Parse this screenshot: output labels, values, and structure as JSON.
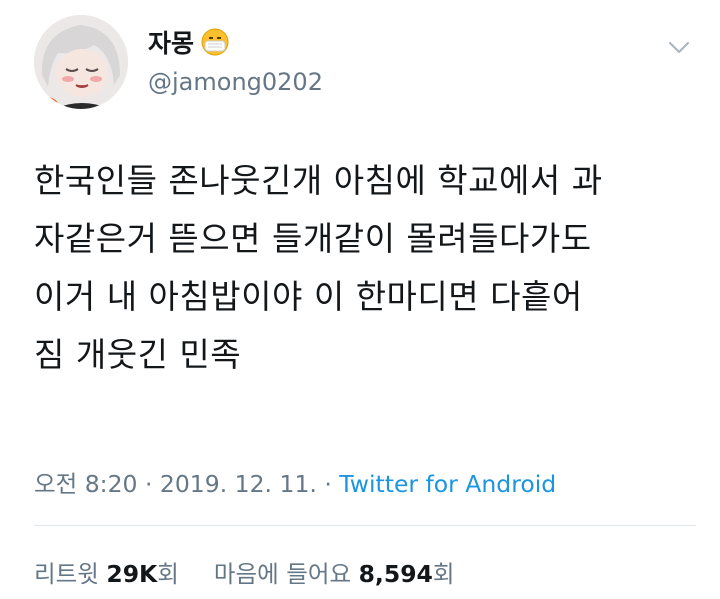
{
  "user": {
    "display_name": "자몽",
    "handle": "@jamong0202",
    "status_emoji": "face-with-medical-mask-icon"
  },
  "tweet": {
    "lines": [
      "한국인들 존나웃긴개 아침에 학교에서 과",
      "자같은거 뜯으면 들개같이 몰려들다가도",
      "이거 내 아침밥이야 이 한마디면 다흩어",
      "짐 개웃긴 민족"
    ]
  },
  "meta": {
    "time": "오전 8:20",
    "sep1": " · ",
    "date": "2019. 12. 11.",
    "sep2": " · ",
    "source": "Twitter for Android"
  },
  "stats": {
    "retweets_label": "리트윗",
    "retweets_count": "29K",
    "retweets_unit": "회",
    "likes_label": "마음에 들어요",
    "likes_count": "8,594",
    "likes_unit": "회"
  },
  "colors": {
    "text": "#14171a",
    "secondary": "#657786",
    "link": "#1b95e0",
    "divider": "#e1e8ed"
  }
}
